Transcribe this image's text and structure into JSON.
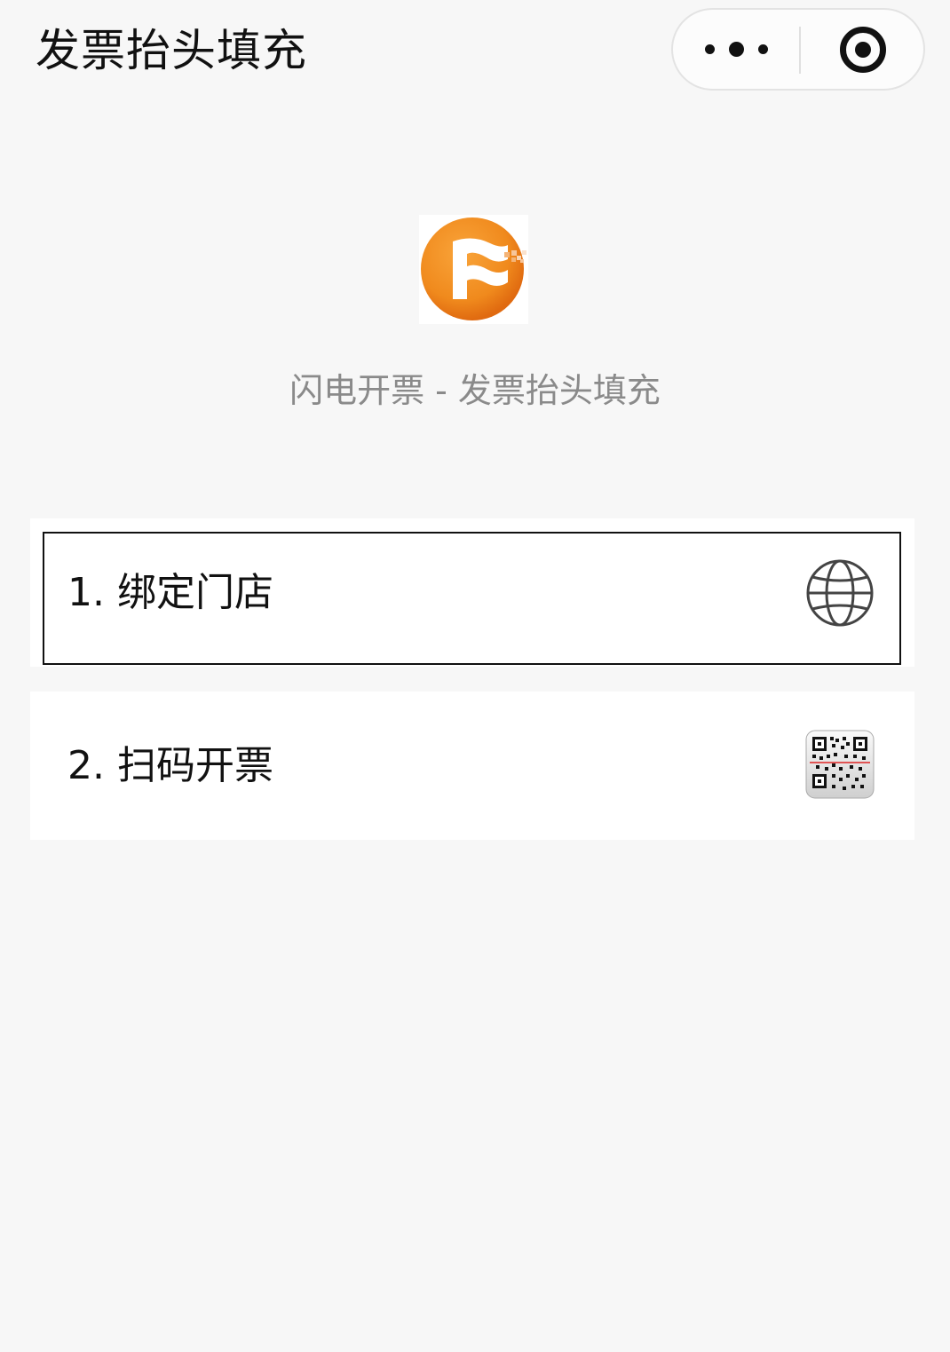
{
  "navbar": {
    "title": "发票抬头填充",
    "more_icon": "more-dots-icon",
    "close_icon": "target-close-icon"
  },
  "header": {
    "logo_icon": "shandian-logo-icon",
    "app_name": "闪电开票 - 发票抬头填充"
  },
  "menu": {
    "items": [
      {
        "label": "1. 绑定门店",
        "icon": "globe-icon",
        "selected": true
      },
      {
        "label": "2. 扫码开票",
        "icon": "qr-code-icon",
        "selected": false
      }
    ]
  },
  "colors": {
    "background": "#f7f7f7",
    "card": "#ffffff",
    "text": "#111111",
    "subtext": "#8a8a8a",
    "logo_orange": "#f08a1d",
    "logo_orange_dark": "#e06a10"
  }
}
